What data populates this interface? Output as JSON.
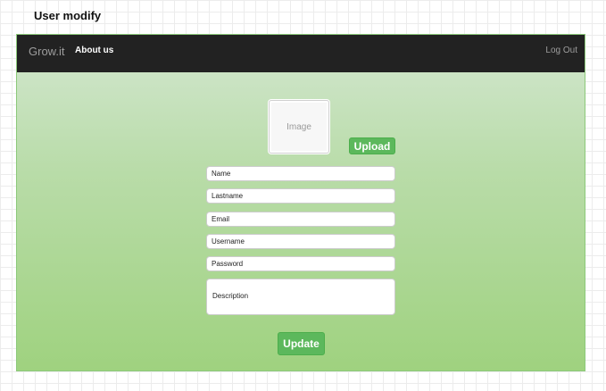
{
  "page": {
    "title": "User modify"
  },
  "navbar": {
    "brand": "Grow.it",
    "about_label": "About us",
    "logout_label": "Log Out"
  },
  "profile": {
    "image_placeholder": "Image",
    "upload_label": "Upload"
  },
  "form": {
    "name_placeholder": "Name",
    "lastname_placeholder": "Lastname",
    "email_placeholder": "Email",
    "username_placeholder": "Username",
    "password_placeholder": "Password",
    "description_placeholder": "Description",
    "update_label": "Update"
  },
  "colors": {
    "navbar_bg": "#222222",
    "button_green": "#5cb85c",
    "gradient_top": "#d3e7d0",
    "gradient_bottom": "#9fd27f"
  }
}
